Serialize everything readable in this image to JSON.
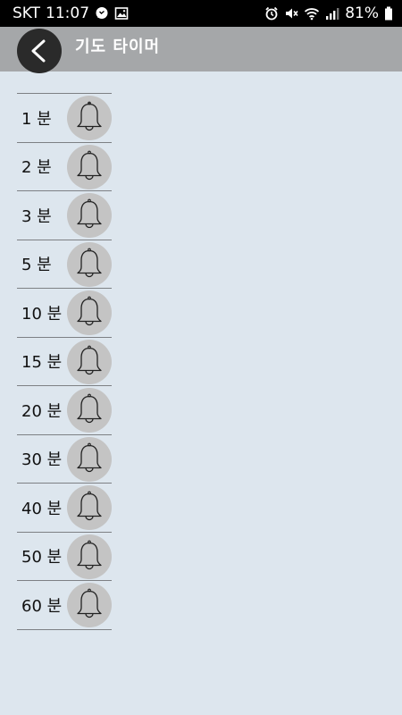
{
  "status_bar": {
    "carrier": "SKT",
    "time": "11:07",
    "battery": "81%",
    "left_icons": [
      "chat-icon",
      "image-icon"
    ],
    "right_icons": [
      "alarm-icon",
      "mute-icon",
      "wifi-icon",
      "signal-icon",
      "battery-icon"
    ]
  },
  "app_bar": {
    "title": "기도 타이머",
    "back_icon": "chevron-left-icon"
  },
  "timers": [
    {
      "label": "1 분"
    },
    {
      "label": "2 분"
    },
    {
      "label": "3 분"
    },
    {
      "label": "5 분"
    },
    {
      "label": "10 분"
    },
    {
      "label": "15 분"
    },
    {
      "label": "20 분"
    },
    {
      "label": "30 분"
    },
    {
      "label": "40 분"
    },
    {
      "label": "50 분"
    },
    {
      "label": "60 분"
    }
  ],
  "item_icon": "bell-icon",
  "colors": {
    "status_bar": "#000000",
    "app_bar": "#a5a7a9",
    "background": "#dde6ee",
    "bell_circle": "#c4c4c4",
    "back_circle": "#2a2a2a"
  }
}
